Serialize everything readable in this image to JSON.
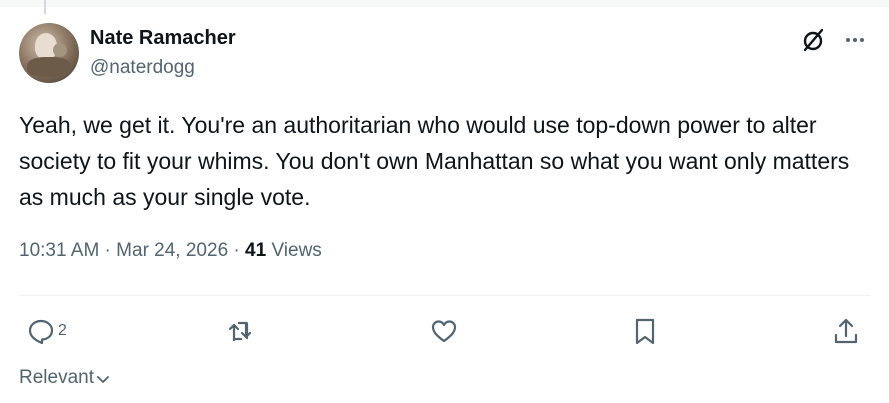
{
  "post": {
    "author_name": "Nate Ramacher",
    "author_handle": "@naterdogg",
    "text": "Yeah, we get it. You're an authoritarian who would use top-down power to alter society to fit your whims. You don't own Manhattan so what you want only matters as much as your single vote.",
    "time": "10:31 AM",
    "separator": " · ",
    "date": "Mar 24, 2026",
    "views_count": "41",
    "views_label": " Views"
  },
  "actions": {
    "reply_count": "2"
  },
  "sort": {
    "label": "Relevant"
  },
  "icons": {
    "grok": "grok-icon",
    "more": "more-icon",
    "reply": "reply-icon",
    "repost": "repost-icon",
    "like": "like-icon",
    "bookmark": "bookmark-icon",
    "share": "share-icon",
    "chevron": "chevron-down-icon"
  },
  "colors": {
    "text_primary": "#0f1419",
    "text_secondary": "#536471",
    "divider": "#eff3f4"
  }
}
